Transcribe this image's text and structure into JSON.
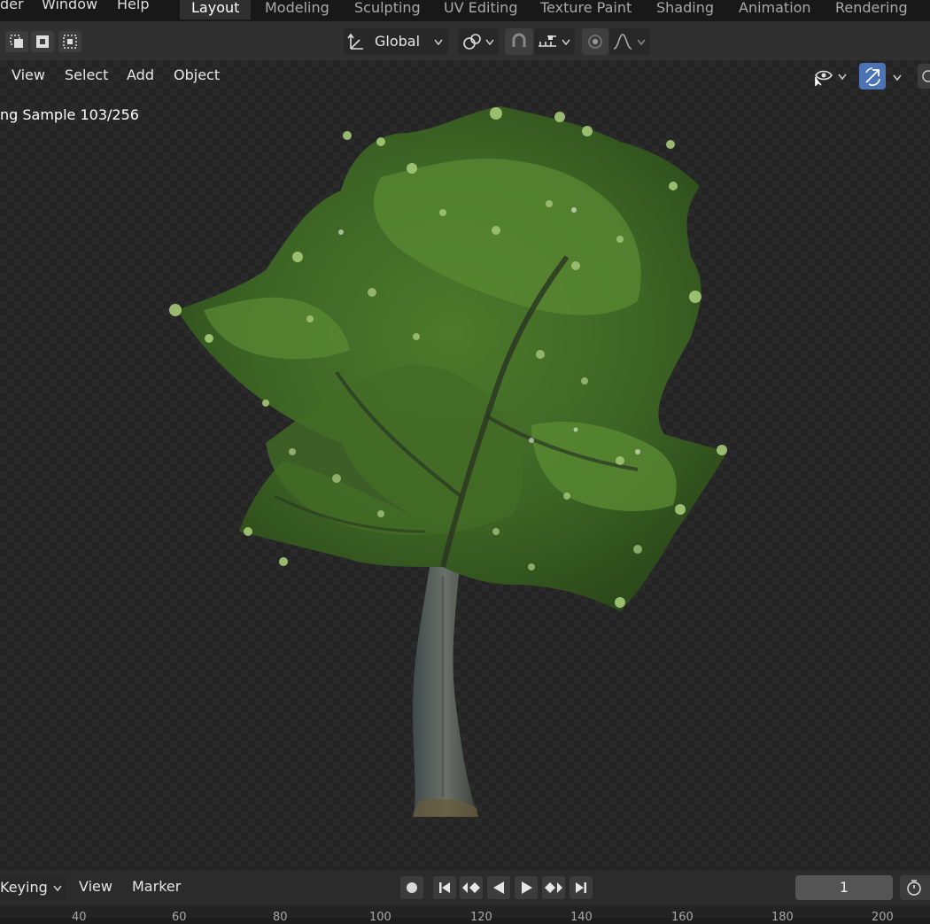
{
  "menu": {
    "render_partial": "der",
    "window": "Window",
    "help": "Help"
  },
  "workspace_tabs": [
    "Layout",
    "Modeling",
    "Sculpting",
    "UV Editing",
    "Texture Paint",
    "Shading",
    "Animation",
    "Rendering"
  ],
  "active_tab": "Layout",
  "header": {
    "transform_orientation": "Global"
  },
  "viewport_menu": [
    "View",
    "Select",
    "Add",
    "Object"
  ],
  "render_status": "ng Sample 103/256",
  "gizmo_active_color": "#4a74b5",
  "timeline": {
    "keying": "Keying",
    "view": "View",
    "marker": "Marker",
    "current_frame": "1",
    "ruler_labels": [
      "40",
      "60",
      "80",
      "100",
      "120",
      "140",
      "160",
      "180",
      "200"
    ]
  }
}
